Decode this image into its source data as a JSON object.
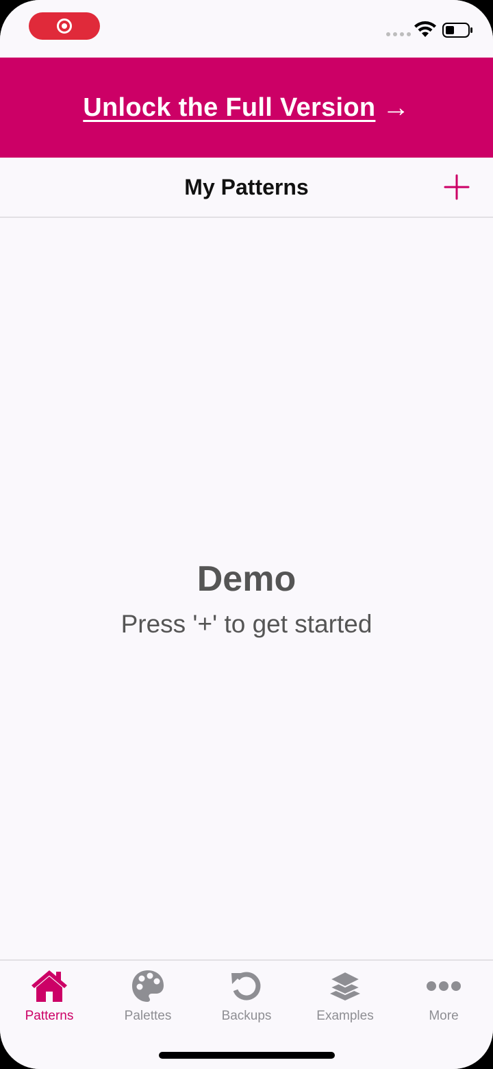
{
  "banner": {
    "link_text": "Unlock the Full Version",
    "arrow": "→"
  },
  "nav": {
    "title": "My Patterns",
    "add_icon": "plus-icon"
  },
  "empty_state": {
    "title": "Demo",
    "subtitle": "Press '+' to get started"
  },
  "tabs": [
    {
      "label": "Patterns",
      "icon": "home-icon",
      "active": true
    },
    {
      "label": "Palettes",
      "icon": "palette-icon",
      "active": false
    },
    {
      "label": "Backups",
      "icon": "restore-icon",
      "active": false
    },
    {
      "label": "Examples",
      "icon": "layers-icon",
      "active": false
    },
    {
      "label": "More",
      "icon": "more-icon",
      "active": false
    }
  ],
  "colors": {
    "accent": "#CC0066",
    "inactive": "#8E8E93",
    "text_dark": "#111111",
    "text_muted": "#555555",
    "background": "#FAF8FC"
  }
}
